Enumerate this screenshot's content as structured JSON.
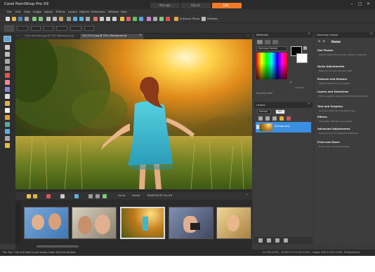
{
  "app": {
    "title": "Corel PaintShop Pro X9"
  },
  "workspace_tabs": [
    {
      "label": "Manage",
      "active": false
    },
    {
      "label": "Adjust",
      "active": false
    },
    {
      "label": "Edit",
      "active": true
    }
  ],
  "menu": [
    "File",
    "Edit",
    "View",
    "Image",
    "Adjust",
    "Effects",
    "Layers",
    "Objects",
    "Selections",
    "Window",
    "Help"
  ],
  "toolbar": {
    "enhance_photo": "Enhance Photo",
    "palettes": "Palettes"
  },
  "doc_tabs": [
    {
      "label": "Film-textures.jpg @ 25% (Background)",
      "active": false
    },
    {
      "label": "320-5713.jpg @ 25% (Background)",
      "active": true
    }
  ],
  "organizer": {
    "go_to": "Go to",
    "folder": "Folder",
    "folder_path": "PAINTSHOP Pro X9"
  },
  "materials": {
    "title": "Materials",
    "palette": "Rainbow Palette",
    "recently_used": "Recently Used",
    "all_tools": "All tools"
  },
  "layers": {
    "title": "Layers",
    "blend_mode": "Normal",
    "opacity": "100",
    "background_layer": "Background"
  },
  "learning": {
    "title": "Learning Center",
    "home": "Home",
    "items": [
      {
        "title": "Get Photos",
        "desc": "Import photos from your PC, camera, or scanner."
      },
      {
        "title": "Quick Adjustments",
        "desc": "Make your photos look their best!"
      },
      {
        "title": "Retouch and Restore",
        "desc": "Remove flaws from your photos."
      },
      {
        "title": "Layers and Selections",
        "desc": "Edit on separate layers and selectively edit areas."
      },
      {
        "title": "Text and Graphics",
        "desc": "Turn your photo into something more."
      },
      {
        "title": "Effects",
        "desc": "Add artistic effects to your photos."
      },
      {
        "title": "Advanced Adjustments",
        "desc": "Enhanced and rich adjustment features."
      },
      {
        "title": "Print and Share",
        "desc": "Print, e-mail, and share photos."
      }
    ]
  },
  "status": {
    "hint": "Pan Tool: Click and drag to pan images larger than the window.",
    "info": "(x:1794 y:479) -- (R:105 G:77 B:114 O:255) -- Image: 3200 x 2133 x RGB - 8 bits/channel"
  },
  "colors": {
    "accent": "#f07a2a",
    "selection": "#3b8fe0",
    "panel": "#3d3d3d",
    "titlebar": "#2a2a2a"
  }
}
